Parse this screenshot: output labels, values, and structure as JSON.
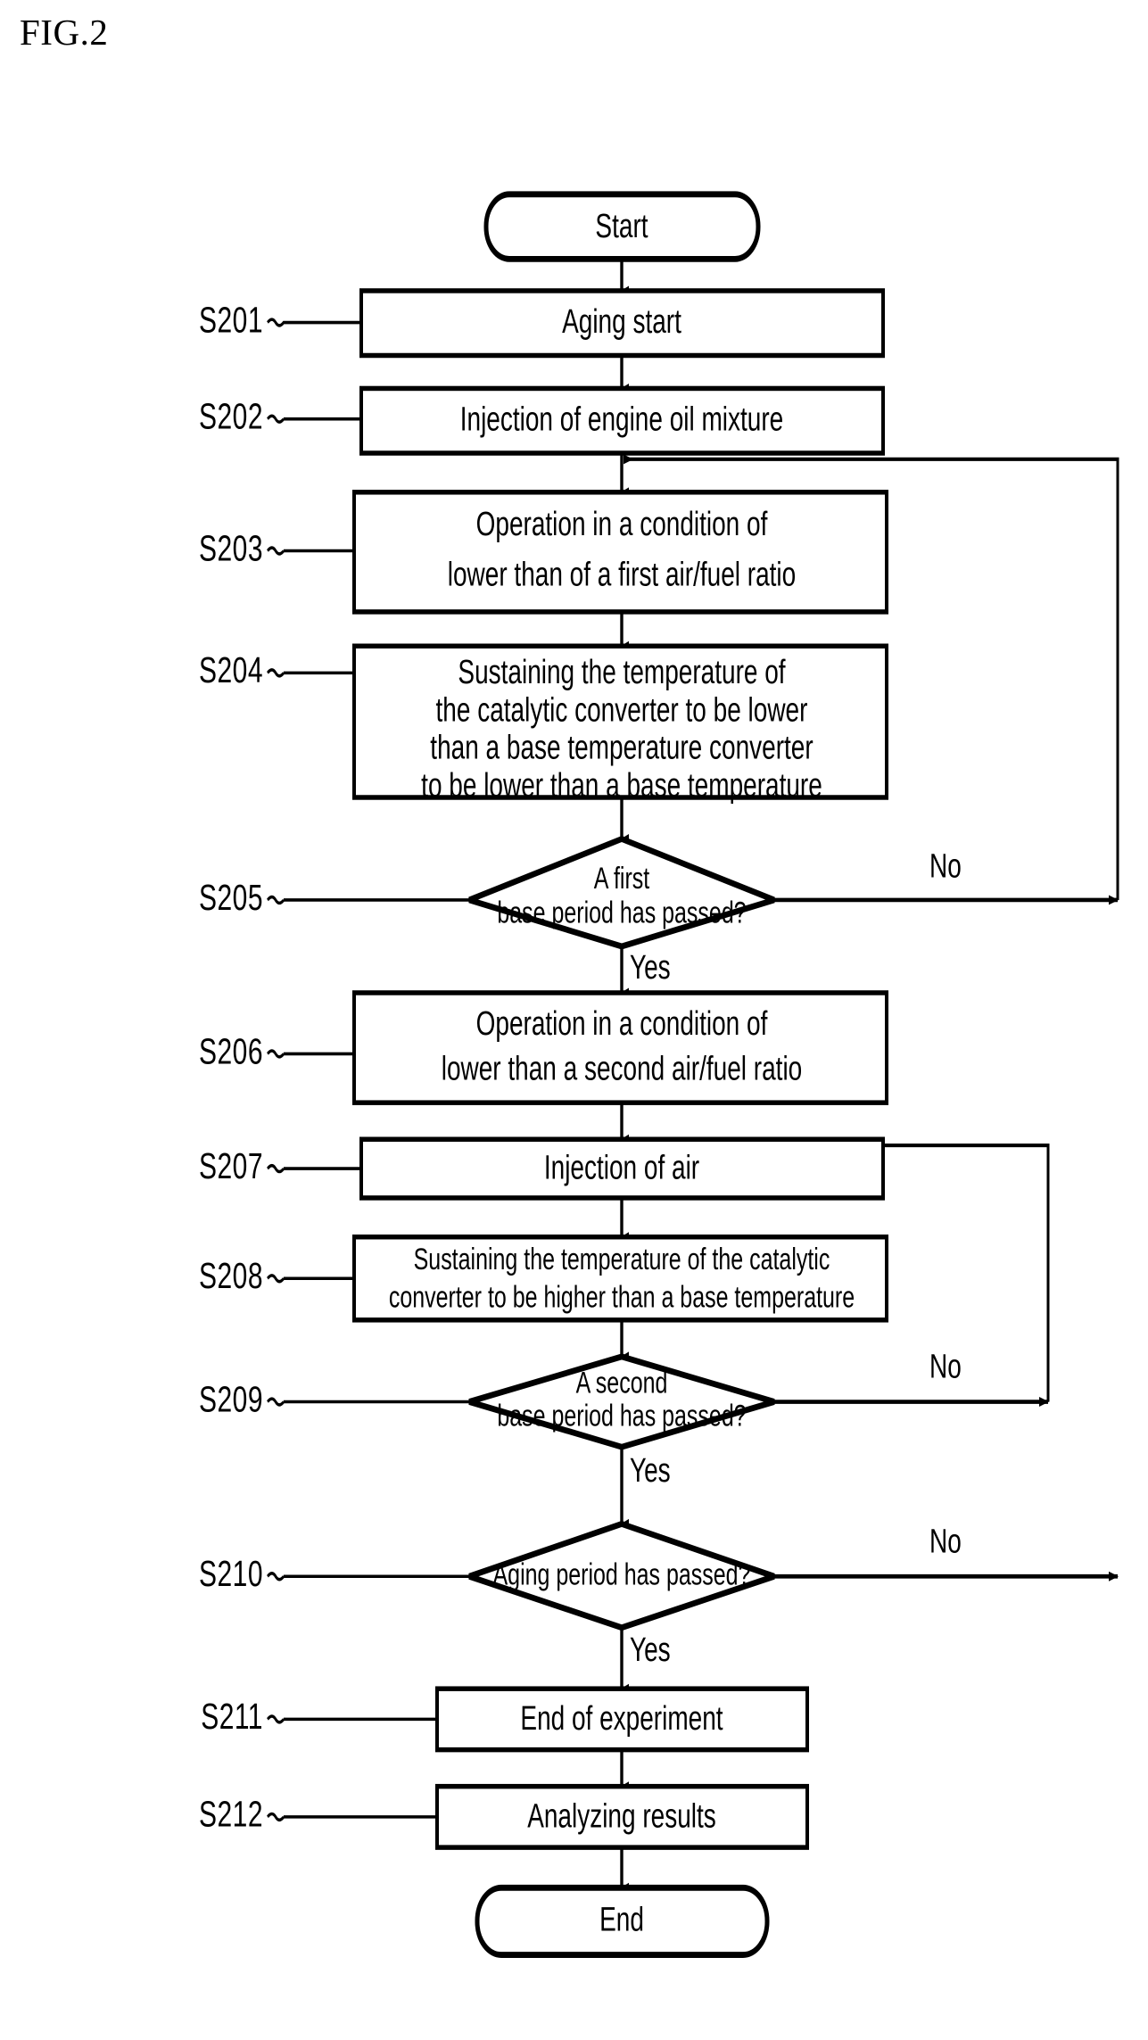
{
  "figure": {
    "title": "FIG.2",
    "type": "flowchart"
  },
  "chart_data": {
    "type": "flowchart",
    "title": "FIG.2",
    "nodes": [
      {
        "id": "start",
        "shape": "terminal",
        "step": "",
        "lines": [
          "Start"
        ]
      },
      {
        "id": "s201",
        "shape": "process",
        "step": "S201",
        "lines": [
          "Aging start"
        ]
      },
      {
        "id": "s202",
        "shape": "process",
        "step": "S202",
        "lines": [
          "Injection of engine oil mixture"
        ]
      },
      {
        "id": "s203",
        "shape": "process",
        "step": "S203",
        "lines": [
          "Operation in a condition of",
          "lower than of a first air/fuel ratio"
        ]
      },
      {
        "id": "s204",
        "shape": "process",
        "step": "S204",
        "lines": [
          "Sustaining the temperature of",
          "the catalytic  converter to be lower",
          "than a base temperature converter",
          "to be lower than a base temperature"
        ]
      },
      {
        "id": "s205",
        "shape": "decision",
        "step": "S205",
        "lines": [
          "A first",
          "base period has passed?"
        ]
      },
      {
        "id": "s206",
        "shape": "process",
        "step": "S206",
        "lines": [
          "Operation in a condition of",
          "lower than a second air/fuel ratio"
        ]
      },
      {
        "id": "s207",
        "shape": "process",
        "step": "S207",
        "lines": [
          "Injection of air"
        ]
      },
      {
        "id": "s208",
        "shape": "process",
        "step": "S208",
        "lines": [
          "Sustaining the temperature of the catalytic",
          "converter to be higher than a base temperature"
        ]
      },
      {
        "id": "s209",
        "shape": "decision",
        "step": "S209",
        "lines": [
          "A second",
          "base period has passed?"
        ]
      },
      {
        "id": "s210",
        "shape": "decision",
        "step": "S210",
        "lines": [
          "Aging period has passed?"
        ]
      },
      {
        "id": "s211",
        "shape": "process",
        "step": "S211",
        "lines": [
          "End of experiment"
        ]
      },
      {
        "id": "s212",
        "shape": "process",
        "step": "S212",
        "lines": [
          "Analyzing results"
        ]
      },
      {
        "id": "end",
        "shape": "terminal",
        "step": "",
        "lines": [
          "End"
        ]
      }
    ],
    "edges": [
      {
        "from": "start",
        "to": "s201",
        "label": ""
      },
      {
        "from": "s201",
        "to": "s202",
        "label": ""
      },
      {
        "from": "s202",
        "to": "s203",
        "label": ""
      },
      {
        "from": "s203",
        "to": "s204",
        "label": ""
      },
      {
        "from": "s204",
        "to": "s205",
        "label": ""
      },
      {
        "from": "s205",
        "to": "s206",
        "label": "Yes"
      },
      {
        "from": "s205",
        "to": "s203",
        "label": "No"
      },
      {
        "from": "s206",
        "to": "s207",
        "label": ""
      },
      {
        "from": "s207",
        "to": "s208",
        "label": ""
      },
      {
        "from": "s208",
        "to": "s209",
        "label": ""
      },
      {
        "from": "s209",
        "to": "s210",
        "label": "Yes"
      },
      {
        "from": "s209",
        "to": "s207",
        "label": "No"
      },
      {
        "from": "s210",
        "to": "s211",
        "label": "Yes"
      },
      {
        "from": "s210",
        "to": "s203",
        "label": "No"
      },
      {
        "from": "s211",
        "to": "s212",
        "label": ""
      },
      {
        "from": "s212",
        "to": "end",
        "label": ""
      }
    ]
  },
  "nodes": {
    "start": {
      "text": "Start"
    },
    "s201": {
      "step": "S201",
      "l0": "Aging start"
    },
    "s202": {
      "step": "S202",
      "l0": "Injection of engine oil mixture"
    },
    "s203": {
      "step": "S203",
      "l0": "Operation in a condition of",
      "l1": "lower than of a first air/fuel ratio"
    },
    "s204": {
      "step": "S204",
      "l0": "Sustaining the temperature of",
      "l1": "the catalytic  converter to be lower",
      "l2": "than a base temperature converter",
      "l3": "to be lower than a base temperature"
    },
    "s205": {
      "step": "S205",
      "l0": "A first",
      "l1": "base period has passed?"
    },
    "s206": {
      "step": "S206",
      "l0": "Operation in a condition of",
      "l1": "lower than a second air/fuel ratio"
    },
    "s207": {
      "step": "S207",
      "l0": "Injection of air"
    },
    "s208": {
      "step": "S208",
      "l0": "Sustaining the temperature of the catalytic",
      "l1": "converter to be higher than a base temperature"
    },
    "s209": {
      "step": "S209",
      "l0": "A second",
      "l1": "base period has passed?"
    },
    "s210": {
      "step": "S210",
      "l0": "Aging period has passed?"
    },
    "s211": {
      "step": "S211",
      "l0": "End of experiment"
    },
    "s212": {
      "step": "S212",
      "l0": "Analyzing results"
    },
    "end": {
      "text": "End"
    }
  },
  "branches": {
    "s205_no": "No",
    "s205_yes": "Yes",
    "s209_no": "No",
    "s209_yes": "Yes",
    "s210_no": "No",
    "s210_yes": "Yes"
  }
}
